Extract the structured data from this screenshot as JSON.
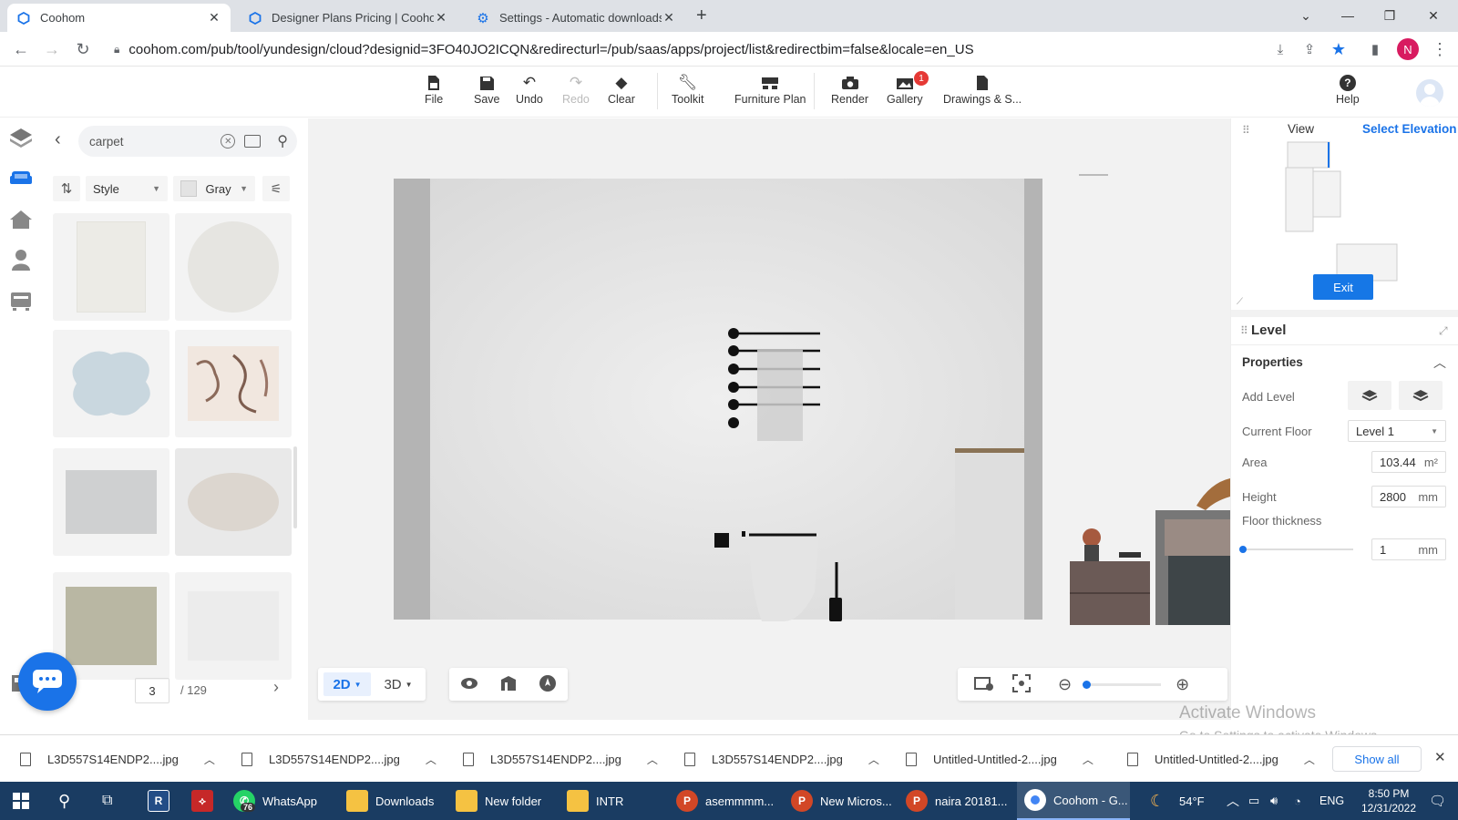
{
  "browser": {
    "tabs": [
      {
        "title": "Coohom",
        "active": true
      },
      {
        "title": "Designer Plans Pricing | Coohom",
        "active": false
      },
      {
        "title": "Settings - Automatic downloads",
        "active": false
      }
    ],
    "url": "coohom.com/pub/tool/yundesign/cloud?designid=3FO40JO2ICQN&redirecturl=/pub/saas/apps/project/list&redirectbim=false&locale=en_US",
    "profile_initial": "N"
  },
  "toolbar": {
    "file": "File",
    "save": "Save",
    "undo": "Undo",
    "redo": "Redo",
    "clear": "Clear",
    "toolkit": "Toolkit",
    "furniture_plan": "Furniture Plan",
    "render": "Render",
    "gallery": "Gallery",
    "gallery_badge": "1",
    "drawings": "Drawings & S...",
    "help": "Help"
  },
  "catalog": {
    "search_value": "carpet",
    "filter_style": "Style",
    "filter_color": "Gray",
    "page_current": "3",
    "page_total": "/ 129"
  },
  "view_toolbar": {
    "mode_2d": "2D",
    "mode_3d": "3D"
  },
  "right_panel": {
    "view_title": "View",
    "select_elevation": "Select Elevation",
    "exit": "Exit",
    "level_title": "Level",
    "properties": "Properties",
    "add_level": "Add Level",
    "current_floor_label": "Current Floor",
    "current_floor_value": "Level 1",
    "area_label": "Area",
    "area_value": "103.44",
    "area_unit": "m²",
    "height_label": "Height",
    "height_value": "2800",
    "height_unit": "mm",
    "floor_thickness_label": "Floor thickness",
    "floor_thickness_value": "1",
    "floor_thickness_unit": "mm"
  },
  "watermark": {
    "line1": "Activate Windows",
    "line2": "Go to Settings to activate Windows."
  },
  "downloads": {
    "items": [
      "L3D557S14ENDP2....jpg",
      "L3D557S14ENDP2....jpg",
      "L3D557S14ENDP2....jpg",
      "L3D557S14ENDP2....jpg",
      "Untitled-Untitled-2....jpg",
      "Untitled-Untitled-2....jpg"
    ],
    "show_all": "Show all"
  },
  "taskbar": {
    "whatsapp": "WhatsApp",
    "whatsapp_badge": "76",
    "downloads": "Downloads",
    "new_folder": "New folder",
    "intr": "INTR",
    "ppt1": "asemmmm...",
    "ppt2": "New Micros...",
    "ppt3": "naira 20181...",
    "chrome": "Coohom - G...",
    "temp": "54°F",
    "lang": "ENG",
    "time": "8:50 PM",
    "date": "12/31/2022"
  },
  "colors": {
    "accent": "#1a73e8",
    "exit_button": "#1677e6",
    "taskbar": "#1a3c62",
    "profile": "#d81b60"
  }
}
